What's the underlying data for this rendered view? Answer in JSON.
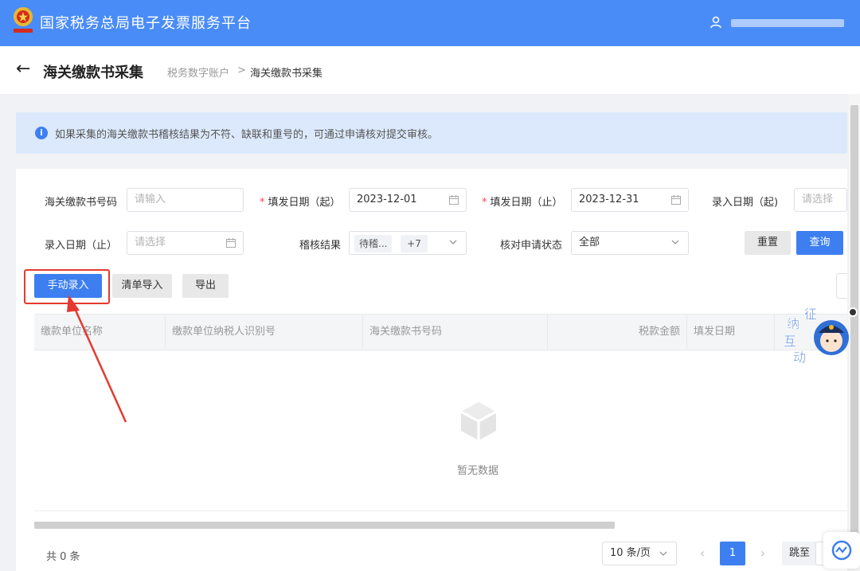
{
  "header": {
    "title": "国家税务总局电子发票服务平台",
    "brand_color": "#4a8cf7"
  },
  "page": {
    "back_icon": "←",
    "title": "海关缴款书采集",
    "breadcrumb": {
      "parent": "税务数字账户",
      "separator": ">",
      "current": "海关缴款书采集"
    }
  },
  "notice": {
    "icon": "i",
    "text": "如果采集的海关缴款书稽核结果为不符、缺联和重号的，可通过申请核对提交审核。"
  },
  "filters": {
    "doc_no_label": "海关缴款书号码",
    "doc_no_placeholder": "请输入",
    "issue_start_label": "填发日期（起）",
    "issue_start_value": "2023-12-01",
    "issue_end_label": "填发日期（止）",
    "issue_end_value": "2023-12-31",
    "entry_start_label": "录入日期（起)",
    "entry_start_placeholder": "请选择",
    "entry_end_label": "录入日期（止）",
    "entry_end_placeholder": "请选择",
    "audit_label": "稽核结果",
    "audit_tag": "待稽...",
    "audit_more_tag": "+7",
    "apply_status_label": "核对申请状态",
    "apply_status_value": "全部",
    "required_mark": "*"
  },
  "buttons": {
    "reset": "重置",
    "query": "查询",
    "manual_entry": "手动录入",
    "list_import": "清单导入",
    "export": "导出"
  },
  "table": {
    "columns": [
      "缴款单位名称",
      "缴款单位纳税人识别号",
      "海关缴款书号码",
      "税款金额",
      "填发日期"
    ],
    "empty_text": "暂无数据"
  },
  "footer": {
    "total": "共 0 条",
    "page_size": "10 条/页",
    "prev": "‹",
    "next": "›",
    "current_page": "1",
    "jump_label": "跳至"
  },
  "mascot": {
    "chars": [
      "征",
      "纳",
      "互",
      "动"
    ]
  },
  "colors": {
    "primary": "#3d7ff0",
    "required": "#f5455f",
    "annotation": "#e53a2f"
  }
}
